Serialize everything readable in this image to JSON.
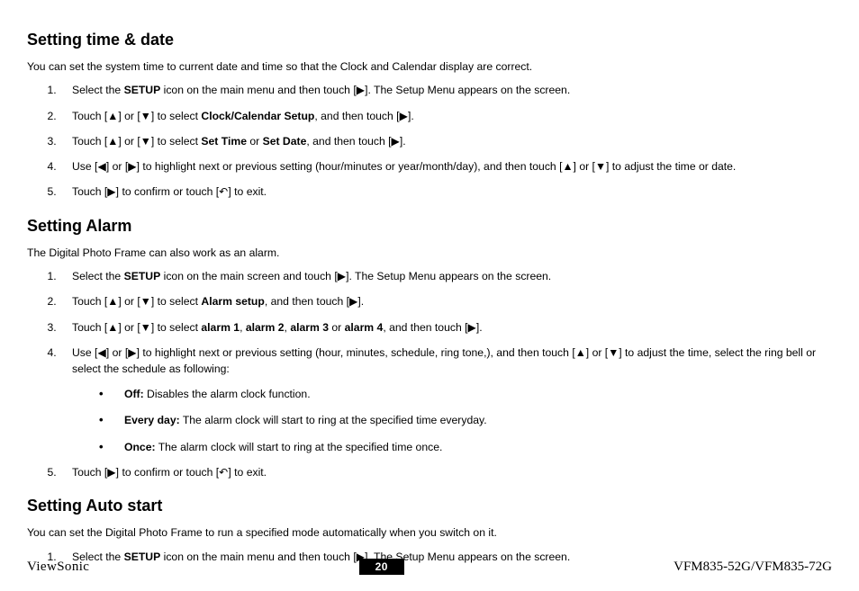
{
  "icons": {
    "right": "▶",
    "left": "◀",
    "up": "▲",
    "down": "▼",
    "back": "↶"
  },
  "sections": {
    "timeDate": {
      "heading": "Setting time & date",
      "intro": "You can set the system time to current date and time so that the Clock and Calendar display are correct.",
      "steps": {
        "s1a": "Select the ",
        "s1b": "SETUP",
        "s1c": " icon on the main menu and then touch [",
        "s1d": "]. The Setup Menu appears on the screen.",
        "s2a": "Touch [",
        "s2b": "] or [",
        "s2c": "] to select ",
        "s2d": "Clock/Calendar Setup",
        "s2e": ", and then touch [",
        "s2f": "].",
        "s3a": "Touch [",
        "s3b": "] or [",
        "s3c": "] to select ",
        "s3d": "Set Time",
        "s3e": " or ",
        "s3f": "Set Date",
        "s3g": ", and then touch [",
        "s3h": "].",
        "s4a": "Use [",
        "s4b": "] or [",
        "s4c": "] to highlight next or previous setting (hour/minutes or year/month/day), and then touch [",
        "s4d": "] or [",
        "s4e": "] to adjust the time or date.",
        "s5a": "Touch [",
        "s5b": "] to confirm or touch [",
        "s5c": "] to exit."
      }
    },
    "alarm": {
      "heading": "Setting Alarm",
      "intro": "The Digital Photo Frame can also work as an alarm.",
      "steps": {
        "s1a": "Select the ",
        "s1b": "SETUP",
        "s1c": " icon on the main screen and touch [",
        "s1d": "]. The Setup Menu appears on the screen.",
        "s2a": "Touch [",
        "s2b": "] or [",
        "s2c": "] to select ",
        "s2d": "Alarm setup",
        "s2e": ", and then touch [",
        "s2f": "].",
        "s3a": "Touch [",
        "s3b": "] or [",
        "s3c": "] to select ",
        "s3d": "alarm 1",
        "s3e": ", ",
        "s3f": "alarm 2",
        "s3g": ", ",
        "s3h": "alarm 3",
        "s3i": " or ",
        "s3j": "alarm 4",
        "s3k": ", and then touch [",
        "s3l": "].",
        "s4a": "Use [",
        "s4b": "] or [",
        "s4c": "] to highlight next or previous setting (hour, minutes, schedule, ring tone,), and then touch [",
        "s4d": "] or [",
        "s4e": "] to adjust the time, select the ring bell or select the schedule as following:",
        "b1a": "Off:",
        "b1b": " Disables the alarm clock function.",
        "b2a": "Every day:",
        "b2b": " The alarm clock will start to ring at the specified time everyday.",
        "b3a": "Once:",
        "b3b": " The alarm clock will start to ring at the specified time once.",
        "s5a": "Touch [",
        "s5b": "] to confirm or touch [",
        "s5c": "] to exit."
      }
    },
    "autoStart": {
      "heading": "Setting Auto start",
      "intro": "You can set the Digital Photo Frame to run a specified mode automatically when you switch on it.",
      "steps": {
        "s1a": "Select the ",
        "s1b": "SETUP",
        "s1c": " icon on the main menu and then touch [",
        "s1d": "]. The Setup Menu appears on the screen."
      }
    }
  },
  "footer": {
    "brand": "ViewSonic",
    "page": "20",
    "model": "VFM835-52G/VFM835-72G"
  }
}
